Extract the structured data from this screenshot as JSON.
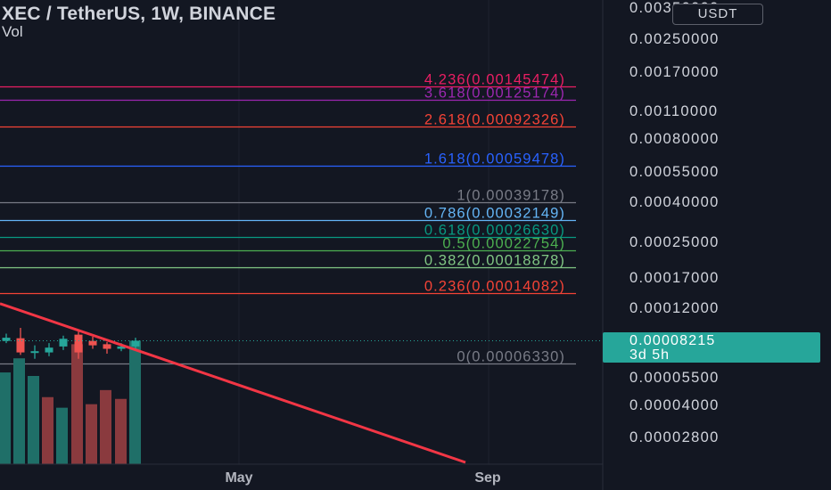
{
  "header": {
    "title": "XEC / TetherUS, 1W, BINANCE",
    "indicator": "Vol"
  },
  "scale_badge": "USDT",
  "last_price": {
    "value": "0.00008215",
    "countdown": "3d 5h",
    "price": 8.215e-05
  },
  "colors": {
    "background": "#131722",
    "up": "#26a69a",
    "down": "#ef5350",
    "trendline": "#f23645"
  },
  "chart_data": {
    "type": "candlestick",
    "y_scale": "log",
    "y_axis_labels": [
      "0.00350000",
      "0.00250000",
      "0.00170000",
      "0.00110000",
      "0.00080000",
      "0.00055000",
      "0.00040000",
      "0.00025000",
      "0.00017000",
      "0.00012000",
      "0.00005500",
      "0.00004000",
      "0.00002800"
    ],
    "x_axis_labels": [
      "May",
      "Sep"
    ],
    "fib_levels": [
      {
        "label": "4.236(0.00145474)",
        "ratio": 4.236,
        "price": 0.00145474,
        "color": "#e91e63"
      },
      {
        "label": "3.618(0.00125174)",
        "ratio": 3.618,
        "price": 0.00125174,
        "color": "#9c27b0"
      },
      {
        "label": "2.618(0.00092326)",
        "ratio": 2.618,
        "price": 0.00092326,
        "color": "#f44336"
      },
      {
        "label": "1.618(0.00059478)",
        "ratio": 1.618,
        "price": 0.00059478,
        "color": "#2962ff"
      },
      {
        "label": "1(0.00039178)",
        "ratio": 1,
        "price": 0.00039178,
        "color": "#787b86"
      },
      {
        "label": "0.786(0.00032149)",
        "ratio": 0.786,
        "price": 0.00032149,
        "color": "#64b5f6"
      },
      {
        "label": "0.618(0.00026630)",
        "ratio": 0.618,
        "price": 0.0002663,
        "color": "#089981"
      },
      {
        "label": "0.5(0.00022754)",
        "ratio": 0.5,
        "price": 0.00022754,
        "color": "#4caf50"
      },
      {
        "label": "0.382(0.00018878)",
        "ratio": 0.382,
        "price": 0.00018878,
        "color": "#81c784"
      },
      {
        "label": "0.236(0.00014082)",
        "ratio": 0.236,
        "price": 0.00014082,
        "color": "#f44336"
      },
      {
        "label": "0(0.00006330)",
        "ratio": 0,
        "price": 6.33e-05,
        "color": "#787b86"
      }
    ],
    "candles": [
      {
        "o": 8.2e-05,
        "h": 8.9e-05,
        "l": 8e-05,
        "c": 8.5e-05
      },
      {
        "o": 8.45e-05,
        "h": 9.5e-05,
        "l": 7e-05,
        "c": 7.2e-05
      },
      {
        "o": 7.2e-05,
        "h": 7.8e-05,
        "l": 6.7e-05,
        "c": 7.3e-05
      },
      {
        "o": 7.2e-05,
        "h": 8e-05,
        "l": 6.9e-05,
        "c": 7.6e-05
      },
      {
        "o": 7.7e-05,
        "h": 8.7e-05,
        "l": 7.4e-05,
        "c": 8.4e-05
      },
      {
        "o": 8.8e-05,
        "h": 9.1e-05,
        "l": 6.7e-05,
        "c": 7.2e-05
      },
      {
        "o": 8.2e-05,
        "h": 8.6e-05,
        "l": 7.5e-05,
        "c": 7.8e-05
      },
      {
        "o": 7.9e-05,
        "h": 8.1e-05,
        "l": 7.1e-05,
        "c": 7.5e-05
      },
      {
        "o": 7.5e-05,
        "h": 8e-05,
        "l": 7.3e-05,
        "c": 7.7e-05
      },
      {
        "o": 7.7e-05,
        "h": 8.5e-05,
        "l": 7.5e-05,
        "c": 8.215e-05
      }
    ],
    "volume": [
      {
        "v": 0.52,
        "up": true
      },
      {
        "v": 0.6,
        "up": true
      },
      {
        "v": 0.5,
        "up": true
      },
      {
        "v": 0.38,
        "up": false
      },
      {
        "v": 0.32,
        "up": true
      },
      {
        "v": 0.68,
        "up": false
      },
      {
        "v": 0.34,
        "up": false
      },
      {
        "v": 0.42,
        "up": false
      },
      {
        "v": 0.37,
        "up": false
      },
      {
        "v": 0.7,
        "up": true
      }
    ],
    "trendline": {
      "price_at_left_edge": 0.000125,
      "price_at_sep": 2.27e-05
    }
  }
}
